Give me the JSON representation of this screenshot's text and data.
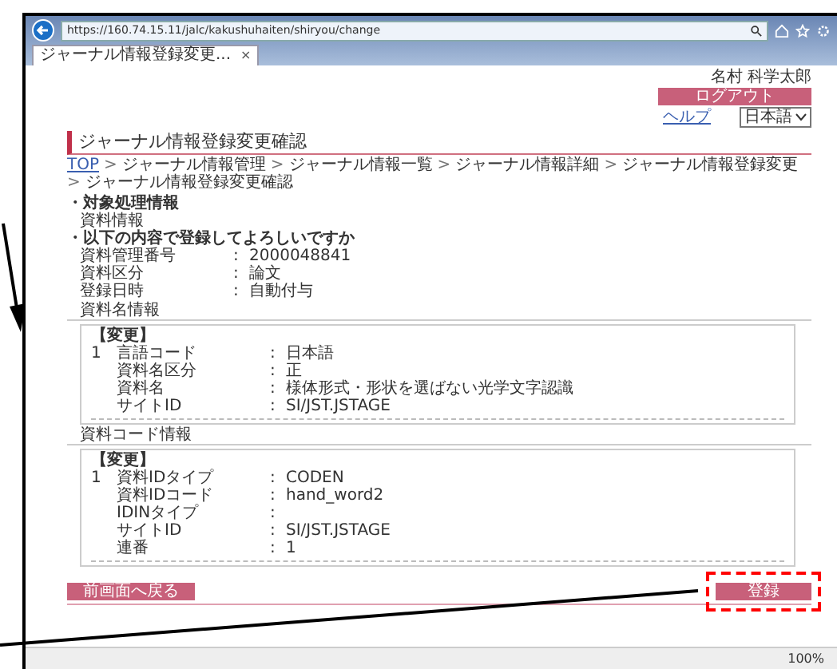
{
  "browser": {
    "url": "https://160.74.15.11/jalc/kakushuhaiten/shiryou/change",
    "tab": "ジャーナル情報登録変更...",
    "tab_close": "×",
    "zoom": "100%"
  },
  "header": {
    "user": "名村 科学太郎",
    "logout": "ログアウト",
    "help": "ヘルプ",
    "language": "日本語"
  },
  "page_title": "ジャーナル情報登録変更確認",
  "breadcrumb_separator": ">",
  "breadcrumb": [
    {
      "label": "TOP",
      "link": true
    },
    {
      "label": "ジャーナル情報管理",
      "link": false
    },
    {
      "label": "ジャーナル情報一覧",
      "link": false
    },
    {
      "label": "ジャーナル情報詳細",
      "link": false
    },
    {
      "label": "ジャーナル情報登録変更",
      "link": false
    },
    {
      "label": "ジャーナル情報登録変更確認",
      "link": false
    }
  ],
  "colon": ":",
  "target_heading": "・対象処理情報",
  "target_value": "資料情報",
  "confirm_heading": "・以下の内容で登録してよろしいですか",
  "fields": [
    {
      "label": "資料管理番号",
      "value": "2000048841"
    },
    {
      "label": "資料区分",
      "value": "論文"
    },
    {
      "label": "登録日時",
      "value": "自動付与"
    }
  ],
  "blocks": [
    {
      "title": "資料名情報",
      "change_label": "【変更】",
      "entries": [
        {
          "number": "1",
          "rows": [
            {
              "label": "言語コード",
              "value": "日本語"
            },
            {
              "label": "資料名区分",
              "value": "正"
            },
            {
              "label": "資料名",
              "value": "様体形式・形状を選ばない光学文字認識"
            },
            {
              "label": "サイトID",
              "value": "SI/JST.JSTAGE"
            }
          ]
        }
      ]
    },
    {
      "title": "資料コード情報",
      "change_label": "【変更】",
      "entries": [
        {
          "number": "1",
          "rows": [
            {
              "label": "資料IDタイプ",
              "value": "CODEN"
            },
            {
              "label": "資料IDコード",
              "value": "hand_word2"
            },
            {
              "label": "IDINタイプ"
            },
            {
              "label": "サイトID",
              "value": "SI/JST.JSTAGE"
            },
            {
              "label": "連番",
              "value": "1"
            }
          ]
        }
      ]
    }
  ],
  "buttons": [
    {
      "label": "前画面へ戻る",
      "kind": "back",
      "highlighted": false
    },
    {
      "label": "登録",
      "kind": "submit",
      "highlighted": true
    }
  ]
}
